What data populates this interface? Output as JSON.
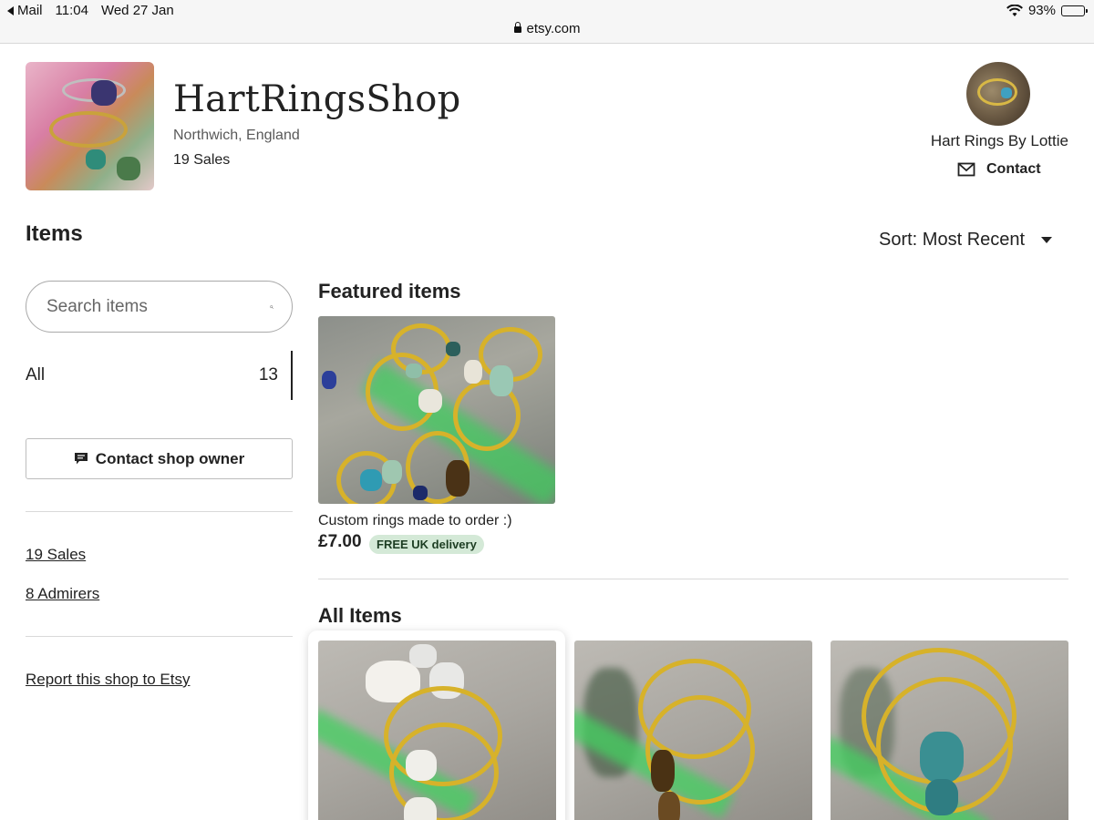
{
  "status_bar": {
    "back_app": "Mail",
    "time": "11:04",
    "date": "Wed 27 Jan",
    "battery": "93%",
    "battery_level": 0.93,
    "url": "etsy.com"
  },
  "shop": {
    "name": "HartRingsShop",
    "location": "Northwich, England",
    "sales": "19 Sales"
  },
  "owner": {
    "name": "Hart Rings By Lottie",
    "contact_label": "Contact"
  },
  "sidebar": {
    "heading": "Items",
    "search_placeholder": "Search items",
    "section_all_label": "All",
    "section_all_count": "13",
    "contact_owner_label": "Contact shop owner",
    "sales_link": "19 Sales",
    "admirers_link": "8 Admirers",
    "report_link": "Report this shop to Etsy"
  },
  "sort": {
    "label": "Sort: Most Recent"
  },
  "featured": {
    "heading": "Featured items",
    "item": {
      "title": "Custom rings made to order :)",
      "price": "£7.00",
      "badge": "FREE UK delivery"
    }
  },
  "all_items": {
    "heading": "All Items"
  },
  "colors": {
    "text": "#222222",
    "badge_bg": "#d4e9d7",
    "ring_gold": "#d7b22a",
    "glow_green": "#3ccf5c"
  }
}
